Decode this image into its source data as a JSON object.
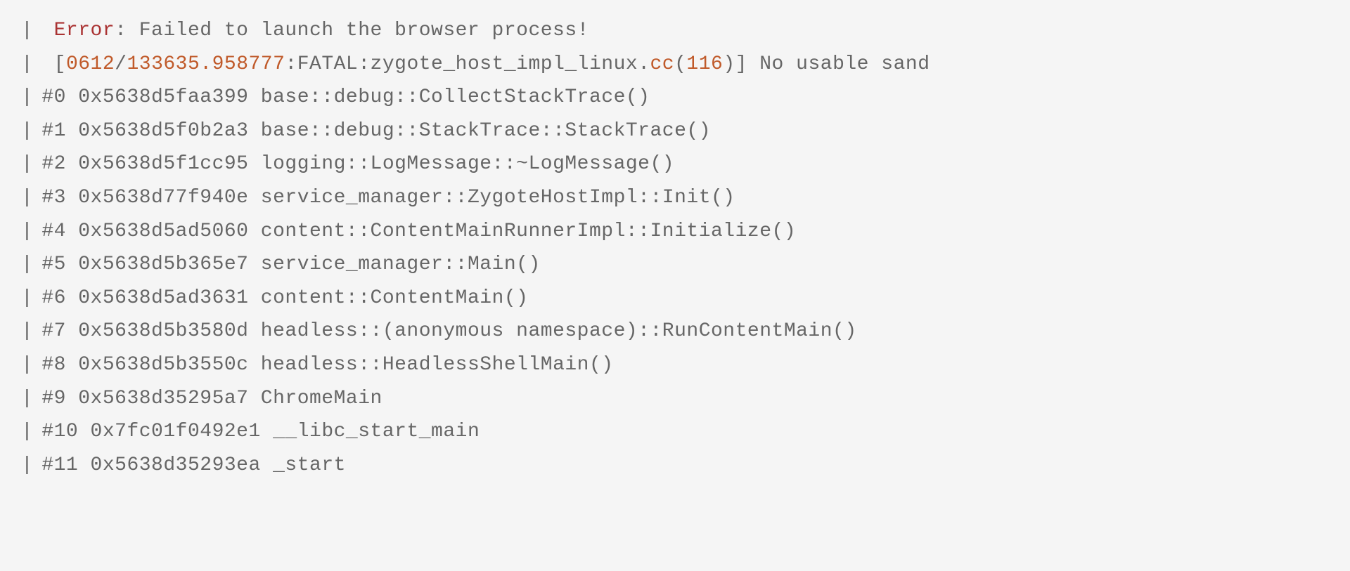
{
  "pipe": "|",
  "error": {
    "label": "Error",
    "sep": ": ",
    "message": "Failed to launch the browser process!"
  },
  "fatal": {
    "open": "[",
    "num1": "0612",
    "slash": "/",
    "num2": "133635.958777",
    "level": ":FATAL:",
    "file": "zygote_host_impl_linux.",
    "ext": "cc",
    "paren_open": "(",
    "linenum": "116",
    "paren_close": ")]",
    "msg": " No usable sand"
  },
  "frames": [
    {
      "idx": "#0",
      "addr": "0x5638d5faa399",
      "sym": "base::debug::CollectStackTrace()"
    },
    {
      "idx": "#1",
      "addr": "0x5638d5f0b2a3",
      "sym": "base::debug::StackTrace::StackTrace()"
    },
    {
      "idx": "#2",
      "addr": "0x5638d5f1cc95",
      "sym": "logging::LogMessage::~LogMessage()"
    },
    {
      "idx": "#3",
      "addr": "0x5638d77f940e",
      "sym": "service_manager::ZygoteHostImpl::Init()"
    },
    {
      "idx": "#4",
      "addr": "0x5638d5ad5060",
      "sym": "content::ContentMainRunnerImpl::Initialize()"
    },
    {
      "idx": "#5",
      "addr": "0x5638d5b365e7",
      "sym": "service_manager::Main()"
    },
    {
      "idx": "#6",
      "addr": "0x5638d5ad3631",
      "sym": "content::ContentMain()"
    },
    {
      "idx": "#7",
      "addr": "0x5638d5b3580d",
      "sym": "headless::(anonymous namespace)::RunContentMain()"
    },
    {
      "idx": "#8",
      "addr": "0x5638d5b3550c",
      "sym": "headless::HeadlessShellMain()"
    },
    {
      "idx": "#9",
      "addr": "0x5638d35295a7",
      "sym": "ChromeMain"
    },
    {
      "idx": "#10",
      "addr": "0x7fc01f0492e1",
      "sym": "__libc_start_main"
    },
    {
      "idx": "#11",
      "addr": "0x5638d35293ea",
      "sym": "_start"
    }
  ]
}
